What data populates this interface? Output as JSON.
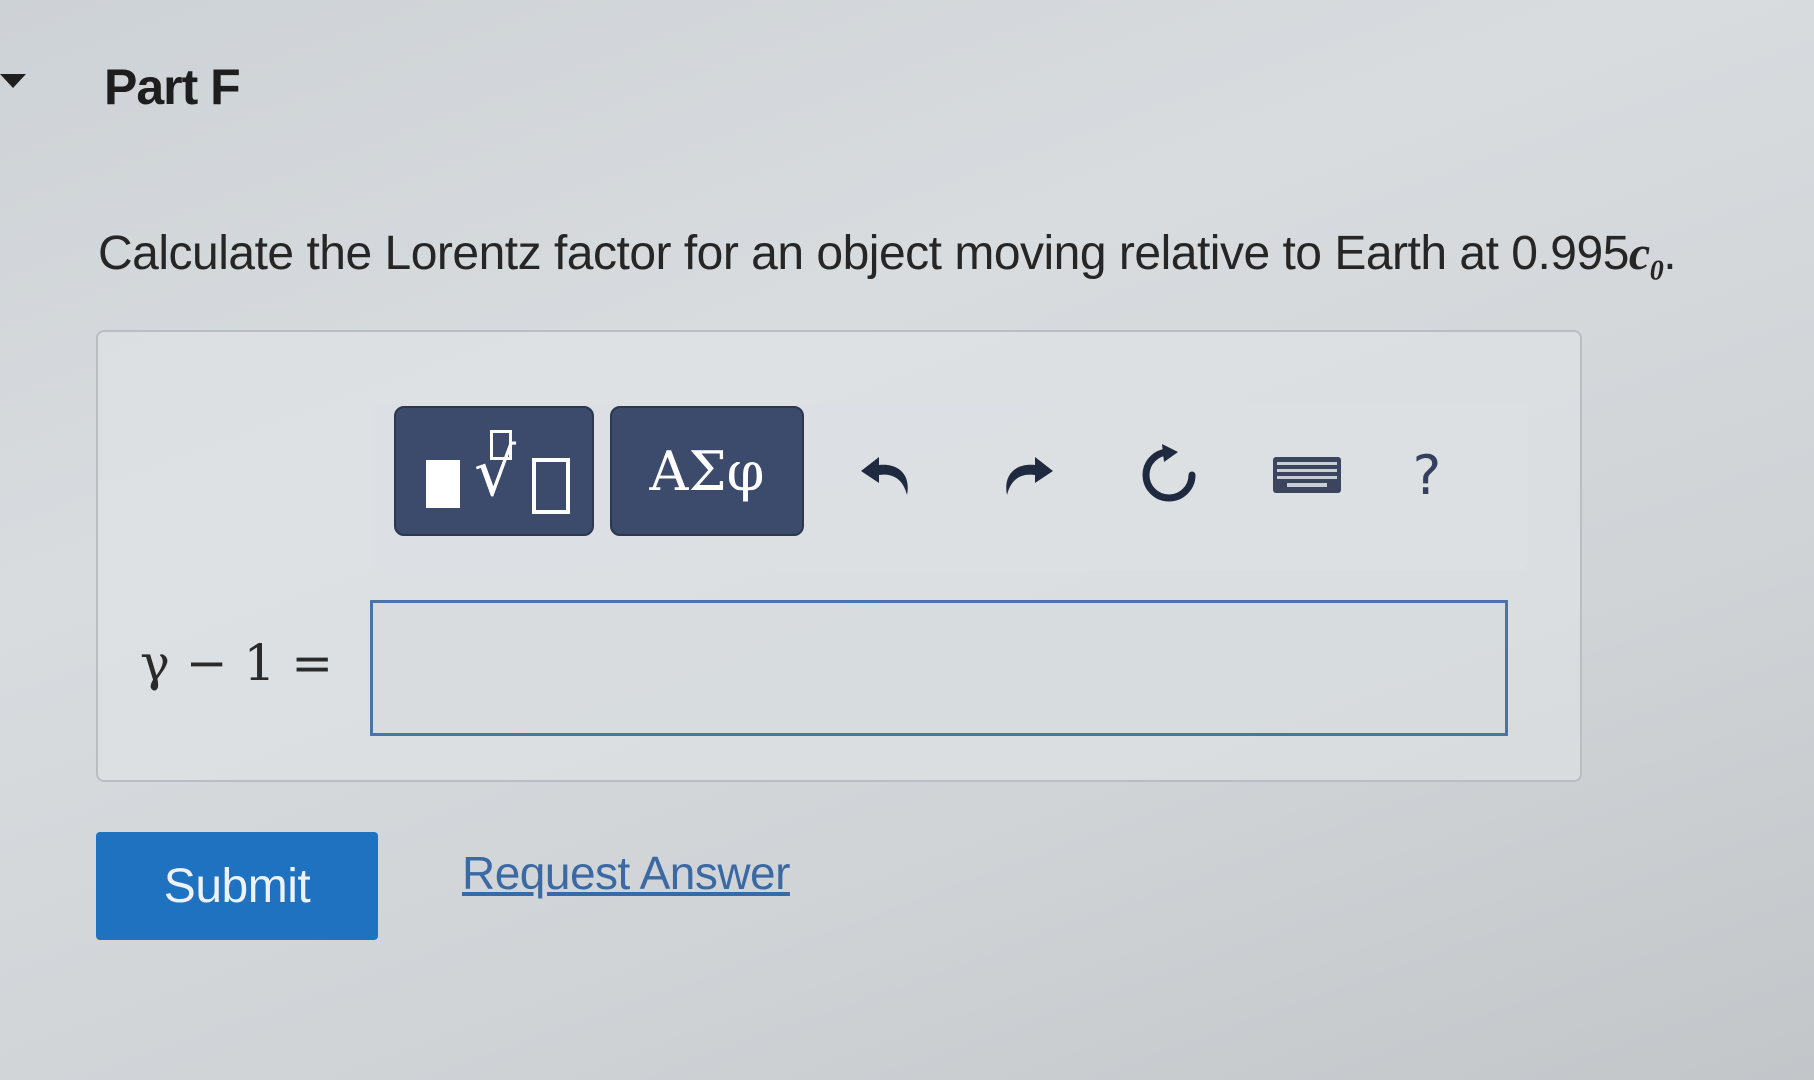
{
  "part": {
    "title": "Part F"
  },
  "question": {
    "text": "Calculate the Lorentz factor for an object moving relative to Earth at 0.995",
    "variable": "c",
    "subscript": "0",
    "end": "."
  },
  "toolbar": {
    "templates_icon": "square-root-template-icon",
    "greek_label": "ΑΣφ",
    "undo_icon": "undo-icon",
    "redo_icon": "redo-icon",
    "reset_icon": "reset-icon",
    "keyboard_icon": "keyboard-icon",
    "help_label": "?"
  },
  "answer": {
    "label": "γ − 1 =",
    "value": ""
  },
  "actions": {
    "submit_label": "Submit",
    "request_label": "Request Answer"
  },
  "colors": {
    "toolbar_button": "#3c4a6c",
    "submit": "#1f72c0",
    "link": "#3b69a4",
    "input_border": "#4a73a8"
  }
}
